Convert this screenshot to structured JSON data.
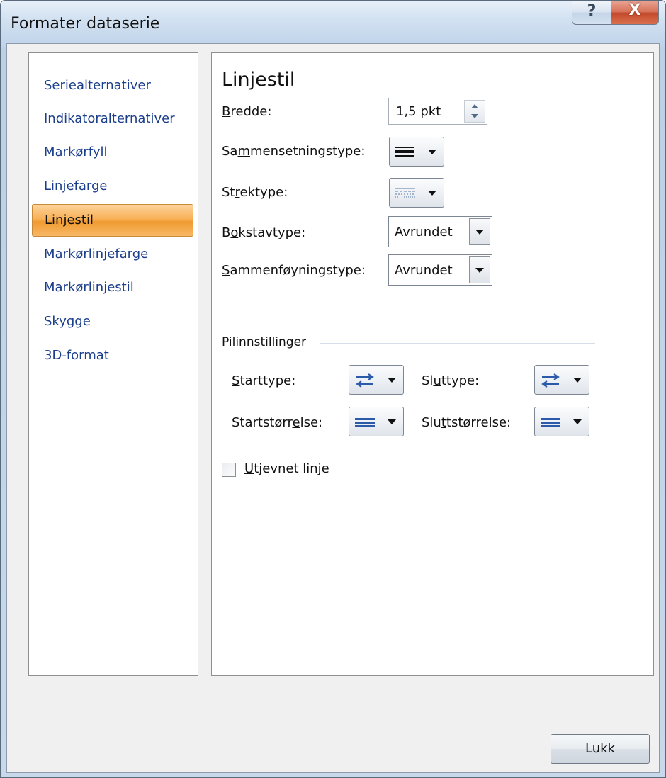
{
  "window": {
    "title": "Formater dataserie",
    "help_glyph": "?",
    "close_glyph": "X"
  },
  "nav": {
    "items": [
      {
        "label": "Seriealternativer"
      },
      {
        "label": "Indikatoralternativer"
      },
      {
        "label": "Markørfyll"
      },
      {
        "label": "Linjefarge"
      },
      {
        "label": "Linjestil",
        "selected": true
      },
      {
        "label": "Markørlinjefarge"
      },
      {
        "label": "Markørlinjestil"
      },
      {
        "label": "Skygge"
      },
      {
        "label": "3D-format"
      }
    ]
  },
  "panel": {
    "heading": "Linjestil",
    "width": {
      "label_pre": "",
      "label_key": "B",
      "label_post": "redde:",
      "value": "1,5 pkt"
    },
    "compound": {
      "label_pre": "Sa",
      "label_key": "m",
      "label_post": "mensetningstype:",
      "icon": "compound-lines-icon"
    },
    "dash": {
      "label_pre": "St",
      "label_key": "r",
      "label_post": "ektype:",
      "icon": "dash-lines-icon"
    },
    "cap": {
      "label_pre": "B",
      "label_key": "o",
      "label_post": "kstavtype:",
      "value": "Avrundet"
    },
    "join": {
      "label_pre": "",
      "label_key": "S",
      "label_post": "ammenføyningstype:",
      "value": "Avrundet"
    },
    "arrows": {
      "group_label": "Pilinnstillinger",
      "start_type": {
        "label_pre": "",
        "label_key": "S",
        "label_post": "tarttype:",
        "icon": "arrow-type-icon"
      },
      "end_type": {
        "label_pre": "Sl",
        "label_key": "u",
        "label_post": "ttype:",
        "icon": "arrow-type-icon"
      },
      "start_size": {
        "label_pre": "Startstørr",
        "label_key": "e",
        "label_post": "lse:",
        "icon": "arrow-size-icon"
      },
      "end_size": {
        "label_pre": "Slu",
        "label_key": "t",
        "label_post": "tstørrelse:",
        "icon": "arrow-size-icon"
      }
    },
    "smooth": {
      "label_pre": "",
      "label_key": "U",
      "label_post": "tjevnet linje",
      "checked": false
    }
  },
  "footer": {
    "close_label": "Lukk"
  },
  "colors": {
    "selected_nav_bg": "#f8b156",
    "nav_text": "#1b3e8c",
    "icon_blue": "#2b5aa8"
  }
}
